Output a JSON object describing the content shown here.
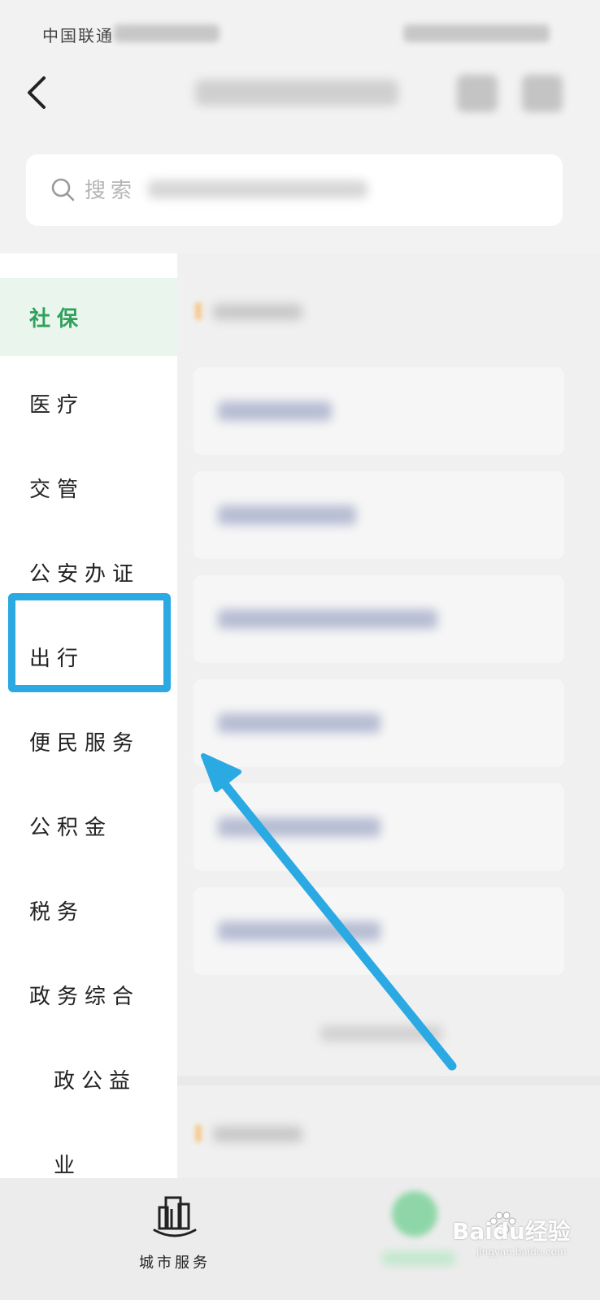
{
  "status_bar": {
    "carrier": "中国联通"
  },
  "search": {
    "placeholder": "搜索"
  },
  "sidebar": {
    "active_index": 0,
    "items": [
      {
        "label": "社保"
      },
      {
        "label": "医疗"
      },
      {
        "label": "交管"
      },
      {
        "label": "公安办证"
      },
      {
        "label": "出行"
      },
      {
        "label": "便民服务"
      },
      {
        "label": "公积金"
      },
      {
        "label": "税务"
      },
      {
        "label": "政务综合"
      },
      {
        "label": "政公益"
      },
      {
        "label": "业"
      }
    ]
  },
  "highlight": {
    "target": "出行",
    "color": "#2aa9e2"
  },
  "tabbar": {
    "city_label": "城市服务"
  },
  "watermark": {
    "brand": "Baidu经验",
    "sub": "jingyan.baidu.com"
  },
  "colors": {
    "accent_green": "#2fa15a",
    "annotation_blue": "#2aa9e2"
  }
}
